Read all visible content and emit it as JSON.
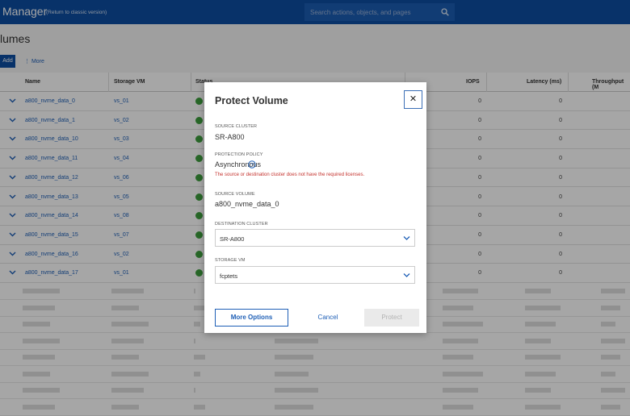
{
  "header": {
    "app_title": "Manager",
    "classic_link": "(Return to classic version)",
    "search_placeholder": "Search actions, objects, and pages"
  },
  "page": {
    "title": "lumes",
    "add_label": "Add",
    "more_label": "⋮ More"
  },
  "table": {
    "columns": [
      "Name",
      "Storage VM",
      "Status",
      "IOPS",
      "Latency (ms)",
      "Throughput (M"
    ],
    "rows": [
      {
        "name": "a800_nvme_data_0",
        "svm": "vs_01",
        "iops": "0",
        "latency": "0"
      },
      {
        "name": "a800_nvme_data_1",
        "svm": "vs_02",
        "iops": "0",
        "latency": "0"
      },
      {
        "name": "a800_nvme_data_10",
        "svm": "vs_03",
        "iops": "0",
        "latency": "0"
      },
      {
        "name": "a800_nvme_data_11",
        "svm": "vs_04",
        "iops": "0",
        "latency": "0"
      },
      {
        "name": "a800_nvme_data_12",
        "svm": "vs_06",
        "iops": "0",
        "latency": "0"
      },
      {
        "name": "a800_nvme_data_13",
        "svm": "vs_05",
        "iops": "0",
        "latency": "0"
      },
      {
        "name": "a800_nvme_data_14",
        "svm": "vs_08",
        "iops": "0",
        "latency": "0"
      },
      {
        "name": "a800_nvme_data_15",
        "svm": "vs_07",
        "iops": "0",
        "latency": "0"
      },
      {
        "name": "a800_nvme_data_16",
        "svm": "vs_02",
        "iops": "0",
        "latency": "0"
      },
      {
        "name": "a800_nvme_data_17",
        "svm": "vs_01",
        "iops": "0",
        "latency": "0"
      }
    ]
  },
  "modal": {
    "title": "Protect Volume",
    "close_label": "✕",
    "source_cluster_label": "SOURCE CLUSTER",
    "source_cluster_value": "SR-A800",
    "policy_label": "PROTECTION POLICY",
    "policy_value": "Asynchronous",
    "policy_error": "The source or destination cluster does not have the required licenses.",
    "source_volume_label": "SOURCE VOLUME",
    "source_volume_value": "a800_nvme_data_0",
    "dest_cluster_label": "DESTINATION CLUSTER",
    "dest_cluster_value": "SR-A800",
    "storage_vm_label": "STORAGE VM",
    "storage_vm_value": "fcptets",
    "more_options_label": "More Options",
    "cancel_label": "Cancel",
    "protect_label": "Protect"
  },
  "colors": {
    "brand": "#0d4da2",
    "link": "#1e5fb6",
    "error": "#c4322d",
    "status_ok": "#3e9f3e"
  },
  "icons": [
    "search-icon",
    "chevron-down-icon",
    "check-circle-icon",
    "close-icon",
    "help-icon"
  ]
}
